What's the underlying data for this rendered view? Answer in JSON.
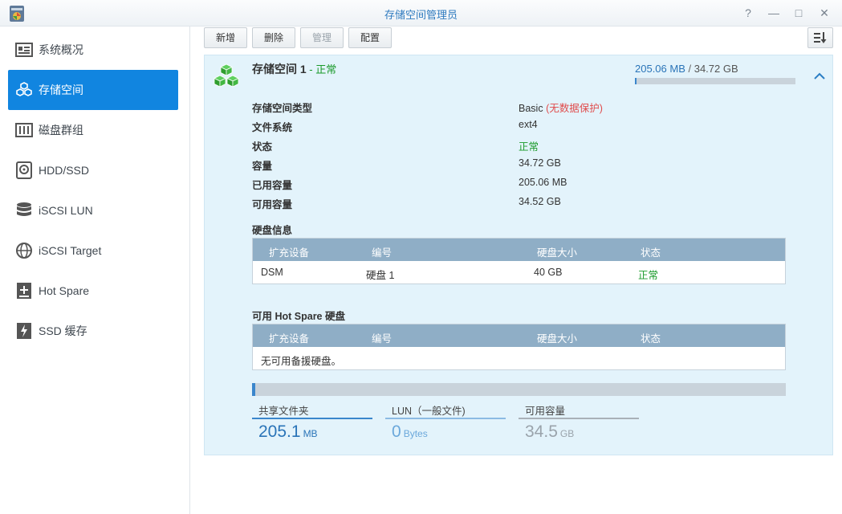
{
  "window": {
    "title": "存储空间管理员",
    "buttons": {
      "help": "?",
      "minimize": "—",
      "maximize": "□",
      "close": "✕"
    }
  },
  "sidebar": {
    "items": [
      {
        "label": "系统概况",
        "icon": "overview-icon"
      },
      {
        "label": "存储空间",
        "icon": "volume-icon",
        "active": true
      },
      {
        "label": "磁盘群组",
        "icon": "disk-group-icon"
      },
      {
        "label": "HDD/SSD",
        "icon": "hdd-icon"
      },
      {
        "label": "iSCSI LUN",
        "icon": "lun-icon"
      },
      {
        "label": "iSCSI Target",
        "icon": "target-icon"
      },
      {
        "label": "Hot Spare",
        "icon": "hot-spare-icon"
      },
      {
        "label": "SSD 缓存",
        "icon": "ssd-cache-icon"
      }
    ]
  },
  "toolbar": {
    "create": "新增",
    "delete": "删除",
    "manage": "管理",
    "configure": "配置"
  },
  "volume": {
    "name": "存储空间 1",
    "dash": " - ",
    "status": "正常",
    "used": "205.06 MB",
    "separator": " / ",
    "total": "34.72 GB",
    "used_fraction": 0.006,
    "details": [
      {
        "label": "存储空间类型",
        "value": "Basic",
        "extra": "(无数据保护)"
      },
      {
        "label": "文件系统",
        "value": "ext4"
      },
      {
        "label": "状态",
        "value": "正常"
      },
      {
        "label": "容量",
        "value": "34.72 GB"
      },
      {
        "label": "已用容量",
        "value": "205.06 MB"
      },
      {
        "label": "可用容量",
        "value": "34.52 GB"
      }
    ]
  },
  "disk_info": {
    "title": "硬盘信息",
    "columns": [
      "扩充设备",
      "编号",
      "硬盘大小",
      "状态"
    ],
    "rows": [
      [
        "DSM",
        "硬盘 1",
        "40 GB",
        "正常"
      ]
    ]
  },
  "hot_spare": {
    "title": "可用 Hot Spare 硬盘",
    "columns": [
      "扩充设备",
      "编号",
      "硬盘大小",
      "状态"
    ],
    "empty_text": "无可用备援硬盘。"
  },
  "stats": [
    {
      "label": "共享文件夹",
      "value": "205.1",
      "unit": "MB",
      "color": "#2a74b8",
      "line": "#3a86cc"
    },
    {
      "label": "LUN（一般文件)",
      "value": "0",
      "unit": "Bytes",
      "color": "#6ba8db",
      "line": "#8cbbe3"
    },
    {
      "label": "可用容量",
      "value": "34.5",
      "unit": "GB",
      "color": "#9aa3ab",
      "line": "#a9b1b8"
    }
  ],
  "colors": {
    "accent": "#1185e0",
    "panel": "#e3f3fb",
    "ok": "#1a9a2a",
    "warn": "#e04b4b",
    "grid_header": "#8faec6"
  }
}
